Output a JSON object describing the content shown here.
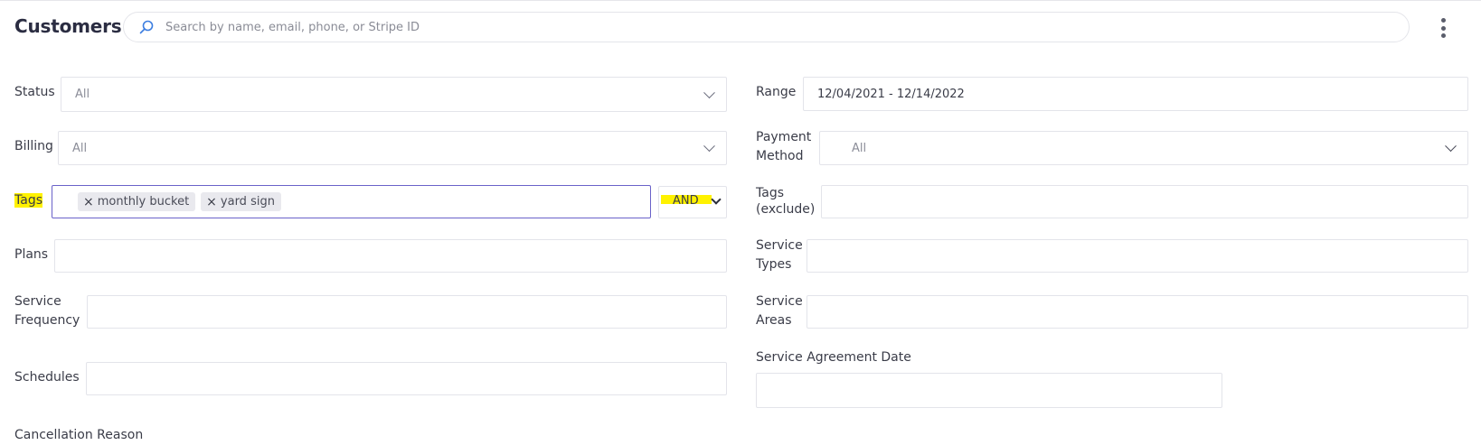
{
  "header": {
    "title": "Customers",
    "search_placeholder": "Search by name, email, phone, or Stripe ID"
  },
  "filters": {
    "status": {
      "label": "Status",
      "value": "All"
    },
    "range": {
      "label": "Range",
      "value": "12/04/2021 - 12/14/2022"
    },
    "billing": {
      "label": "Billing",
      "value": "All"
    },
    "payment_method": {
      "label_line1": "Payment",
      "label_line2": "Method",
      "value": "All"
    },
    "tags": {
      "label": "Tags",
      "chips": [
        "monthly bucket",
        "yard sign"
      ],
      "operator": "AND"
    },
    "tags_exclude": {
      "label_line1": "Tags",
      "label_line2": "(exclude)"
    },
    "plans": {
      "label": "Plans"
    },
    "service_types": {
      "label_line1": "Service",
      "label_line2": "Types"
    },
    "service_frequency": {
      "label_line1": "Service",
      "label_line2": "Frequency"
    },
    "service_areas": {
      "label_line1": "Service",
      "label_line2": "Areas"
    },
    "schedules": {
      "label": "Schedules"
    },
    "service_agreement_date": {
      "label": "Service Agreement Date"
    },
    "cancellation_reason": {
      "label": "Cancellation Reason"
    }
  },
  "colors": {
    "accent_border": "#6a62c9",
    "highlight": "#fff200"
  },
  "icons": {
    "search": "search-icon",
    "menu": "kebab-menu-icon"
  }
}
